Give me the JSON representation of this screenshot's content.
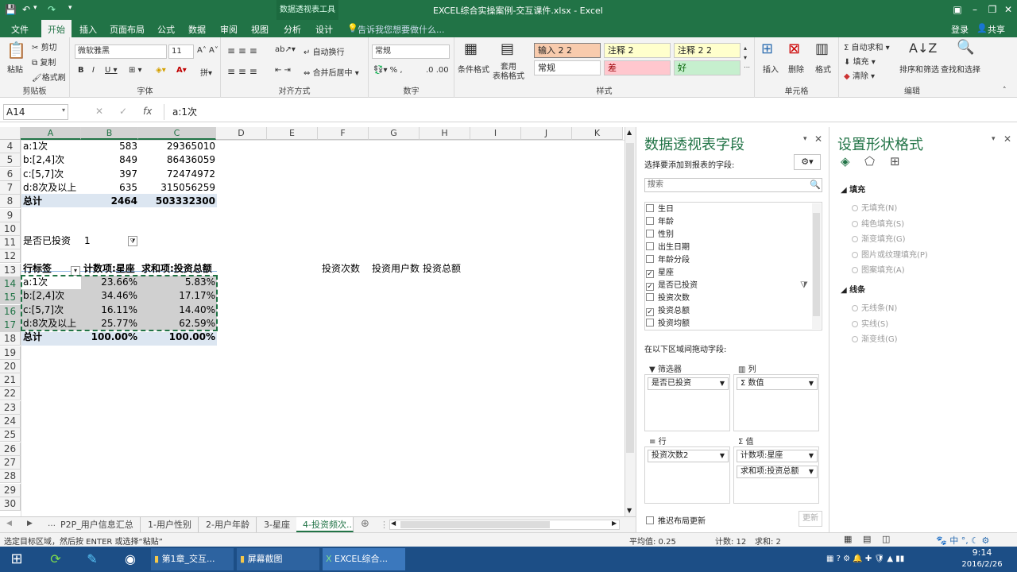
{
  "window": {
    "title": "EXCEL综合实操案例-交互课件.xlsx - Excel",
    "context_tab": "数据透视表工具"
  },
  "ribbon_tabs": [
    "文件",
    "开始",
    "插入",
    "页面布局",
    "公式",
    "数据",
    "审阅",
    "视图",
    "分析",
    "设计"
  ],
  "tell_me": "告诉我您想要做什么...",
  "account": {
    "signin": "登录",
    "share": "共享"
  },
  "ribbon": {
    "clipboard": {
      "label": "剪贴板",
      "paste": "粘贴",
      "cut": "剪切",
      "copy": "复制",
      "format_painter": "格式刷"
    },
    "font": {
      "label": "字体",
      "name": "微软雅黑",
      "size": "11"
    },
    "alignment": {
      "label": "对齐方式",
      "wrap": "自动换行",
      "merge": "合并后居中"
    },
    "number": {
      "label": "数字",
      "format": "常规"
    },
    "styles": {
      "label": "样式",
      "cond_format": "条件格式",
      "table_format": "套用\n表格格式",
      "cells": [
        "输入 2 2",
        "注释 2",
        "注释 2 2",
        "常规",
        "差",
        "好"
      ]
    },
    "cells_grp": {
      "label": "单元格",
      "insert": "插入",
      "delete": "删除",
      "format": "格式"
    },
    "editing": {
      "label": "编辑",
      "autosum": "自动求和",
      "fill": "填充",
      "clear": "清除",
      "sort": "排序和筛选",
      "find": "查找和选择"
    }
  },
  "formula_bar": {
    "name_box": "A14",
    "formula": "a:1次",
    "fx": "fx"
  },
  "columns": [
    "A",
    "B",
    "C",
    "D",
    "E",
    "F",
    "G",
    "H",
    "I",
    "J",
    "K"
  ],
  "rows": [
    "4",
    "5",
    "6",
    "7",
    "8",
    "9",
    "10",
    "11",
    "12",
    "13",
    "14",
    "15",
    "16",
    "17",
    "18",
    "19",
    "20",
    "21",
    "22",
    "23",
    "24",
    "25",
    "26",
    "27",
    "28",
    "29",
    "30"
  ],
  "table1": [
    {
      "a": "a:1次",
      "b": "583",
      "c": "29365010"
    },
    {
      "a": "b:[2,4]次",
      "b": "849",
      "c": "86436059"
    },
    {
      "a": "c:[5,7]次",
      "b": "397",
      "c": "72474972"
    },
    {
      "a": "d:8次及以上",
      "b": "635",
      "c": "315056259"
    },
    {
      "a": "总计",
      "b": "2464",
      "c": "503332300"
    }
  ],
  "filter": {
    "label": "是否已投资",
    "value": "1"
  },
  "pivot": {
    "headers": [
      "行标签",
      "计数项:星座",
      "求和项:投资总额"
    ],
    "rows": [
      {
        "a": "a:1次",
        "b": "23.66%",
        "c": "5.83%"
      },
      {
        "a": "b:[2,4]次",
        "b": "34.46%",
        "c": "17.17%"
      },
      {
        "a": "c:[5,7]次",
        "b": "16.11%",
        "c": "14.40%"
      },
      {
        "a": "d:8次及以上",
        "b": "25.77%",
        "c": "62.59%"
      },
      {
        "a": "总计",
        "b": "100.00%",
        "c": "100.00%"
      }
    ]
  },
  "row13_extra": [
    "投资次数",
    "投资用户数",
    "投资总额"
  ],
  "sheet_tabs": [
    "P2P_用户信息汇总",
    "1-用户性别",
    "2-用户年龄",
    "3-星座",
    "4-投资频次..."
  ],
  "status": {
    "msg": "选定目标区域，然后按 ENTER 或选择“粘贴”",
    "avg": "平均值: 0.25",
    "count": "计数: 12",
    "sum": "求和: 2"
  },
  "pivot_panel": {
    "title": "数据透视表字段",
    "subtitle": "选择要添加到报表的字段:",
    "search_placeholder": "搜索",
    "fields": [
      {
        "name": "生日",
        "checked": false
      },
      {
        "name": "年龄",
        "checked": false
      },
      {
        "name": "性别",
        "checked": false
      },
      {
        "name": "出生日期",
        "checked": false
      },
      {
        "name": "年龄分段",
        "checked": false
      },
      {
        "name": "星座",
        "checked": true
      },
      {
        "name": "是否已投资",
        "checked": true
      },
      {
        "name": "投资次数",
        "checked": false
      },
      {
        "name": "投资总额",
        "checked": true
      },
      {
        "name": "投资均额",
        "checked": false
      }
    ],
    "drag_label": "在以下区域间拖动字段:",
    "areas": {
      "filter": {
        "title": "筛选器",
        "items": [
          "是否已投资"
        ]
      },
      "columns": {
        "title": "列",
        "items": [
          "Σ 数值"
        ]
      },
      "rows": {
        "title": "行",
        "items": [
          "投资次数2"
        ]
      },
      "values": {
        "title": "值",
        "items": [
          "计数项:星座",
          "求和项:投资总额"
        ]
      }
    },
    "defer": "推迟布局更新",
    "update": "更新"
  },
  "shape_panel": {
    "title": "设置形状格式",
    "fill_section": "填充",
    "fill_opts": [
      "无填充(N)",
      "纯色填充(S)",
      "渐变填充(G)",
      "图片或纹理填充(P)",
      "图案填充(A)"
    ],
    "line_section": "线条",
    "line_opts": [
      "无线条(N)",
      "实线(S)",
      "渐变线(G)"
    ]
  },
  "taskbar": {
    "items": [
      "第1章_交互...",
      "屏幕截图",
      "EXCEL综合..."
    ],
    "time": "9:14",
    "date": "2016/2/26",
    "ime": "中"
  },
  "colors": {
    "excel_green": "#217346",
    "taskbar": "#1c4e86"
  }
}
